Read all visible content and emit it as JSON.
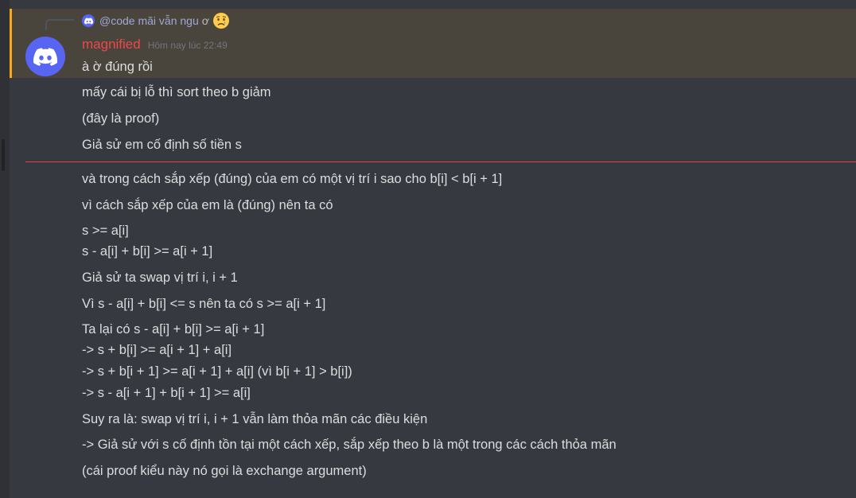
{
  "reply": {
    "mention": "@code mãi vẫn ngu",
    "text": "ơ",
    "emoji": "crying-face-emoji"
  },
  "message": {
    "username": "magnified",
    "timestamp": "Hôm nay lúc 22:49",
    "lines": [
      "à ờ đúng rồi",
      "mấy cái bị lỗ thì sort theo b giảm",
      "(đây là proof)",
      "Giả sử em cố định số tiền s",
      "và trong cách sắp xếp (đúng) của em có một vị trí i sao cho b[i] < b[i + 1]",
      "vì cách sắp xếp của em là (đúng) nên ta có",
      "s >= a[i]",
      "s - a[i] + b[i] >= a[i + 1]",
      "Giả sử ta swap vị trí i, i + 1",
      "Vì s - a[i] + b[i] <= s nên ta có s >= a[i + 1]",
      "Ta lại có s - a[i] + b[i] >= a[i + 1]",
      "-> s + b[i] >= a[i + 1] + a[i]",
      "-> s + b[i + 1] >= a[i + 1] + a[i] (vì b[i + 1] > b[i])",
      "-> s - a[i + 1] + b[i + 1] >= a[i]",
      "Suy ra là: swap vị trí i, i + 1 vẫn làm thỏa mãn các điều kiện",
      "-> Giả sử với s cố định tồn tại một cách xếp, sắp xếp theo b là một trong các cách thỏa mãn",
      "(cái proof kiểu này nó gọi là exchange argument)"
    ]
  },
  "colors": {
    "background": "#36393f",
    "mention_highlight": "#49443c",
    "mention_bar": "#faa81a",
    "username": "#f04747",
    "new_messages_divider": "#ed4245",
    "avatar": "#5865f2"
  }
}
